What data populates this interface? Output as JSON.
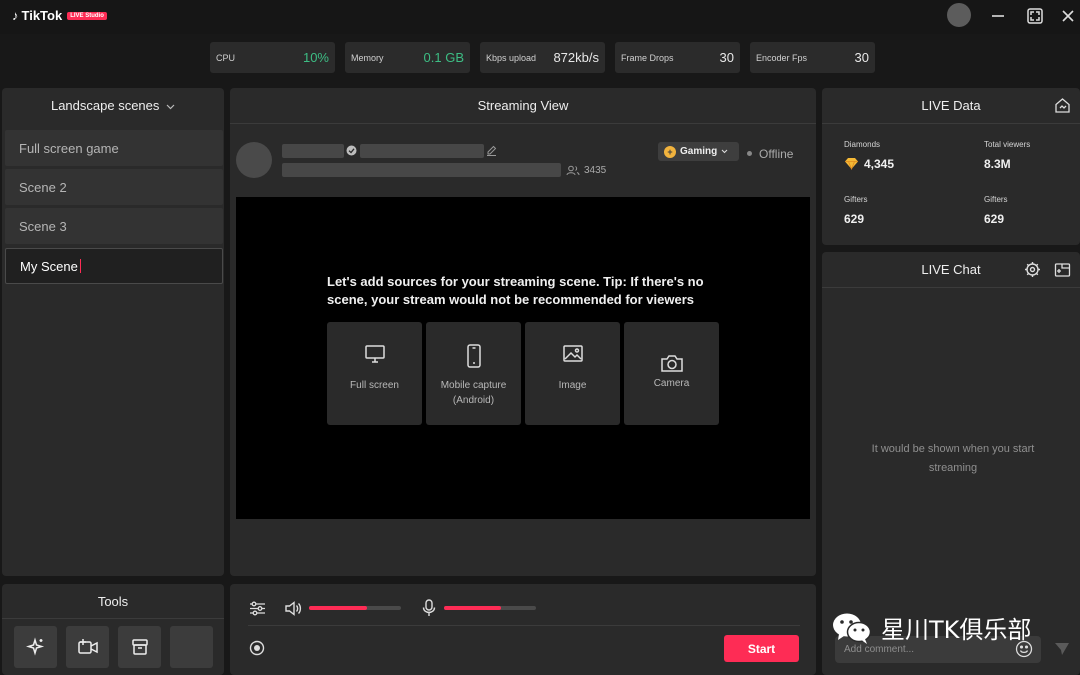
{
  "app": {
    "name": "TikTok",
    "badge": "LIVE Studio"
  },
  "stats": [
    {
      "label": "CPU",
      "value": "10%"
    },
    {
      "label": "Memory",
      "value": "0.1 GB"
    },
    {
      "label": "Kbps upload",
      "value": "872kb/s"
    },
    {
      "label": "Frame Drops",
      "value": "30"
    },
    {
      "label": "Encoder Fps",
      "value": "30"
    }
  ],
  "scenes": {
    "title": "Landscape scenes",
    "items": [
      "Full screen game",
      "Scene 2",
      "Scene 3",
      "My Scene"
    ],
    "active_index": 3
  },
  "tools": {
    "title": "Tools"
  },
  "streaming": {
    "title": "Streaming View",
    "viewer_count": "3435",
    "category": "Gaming",
    "status": "Offline",
    "tip": "Let's add sources for your streaming scene. Tip: If there's no scene, your stream would not be recommended for viewers",
    "sources": [
      {
        "label": "Full screen",
        "icon": "monitor-icon"
      },
      {
        "label": "Mobile capture (Android)",
        "icon": "phone-icon"
      },
      {
        "label": "Image",
        "icon": "image-icon"
      },
      {
        "label": "Camera",
        "icon": "camera-icon"
      }
    ],
    "speaker_volume": 0.63,
    "mic_volume": 0.62,
    "start_label": "Start"
  },
  "live_data": {
    "title": "LIVE Data",
    "diamonds_label": "Diamonds",
    "diamonds_value": "4,345",
    "total_viewers_label": "Total viewers",
    "total_viewers_value": "8.3M",
    "gifters_label_1": "Gifters",
    "gifters_value_1": "629",
    "gifters_label_2": "Gifters",
    "gifters_value_2": "629"
  },
  "live_chat": {
    "title": "LIVE Chat",
    "empty_text": "It would be shown when you start streaming",
    "comment_placeholder": "Add comment..."
  },
  "watermark": "星川TK俱乐部",
  "colors": {
    "accent": "#fe2c55",
    "green": "#3dbd84",
    "panel": "#2a2a2a",
    "background": "#181818"
  }
}
